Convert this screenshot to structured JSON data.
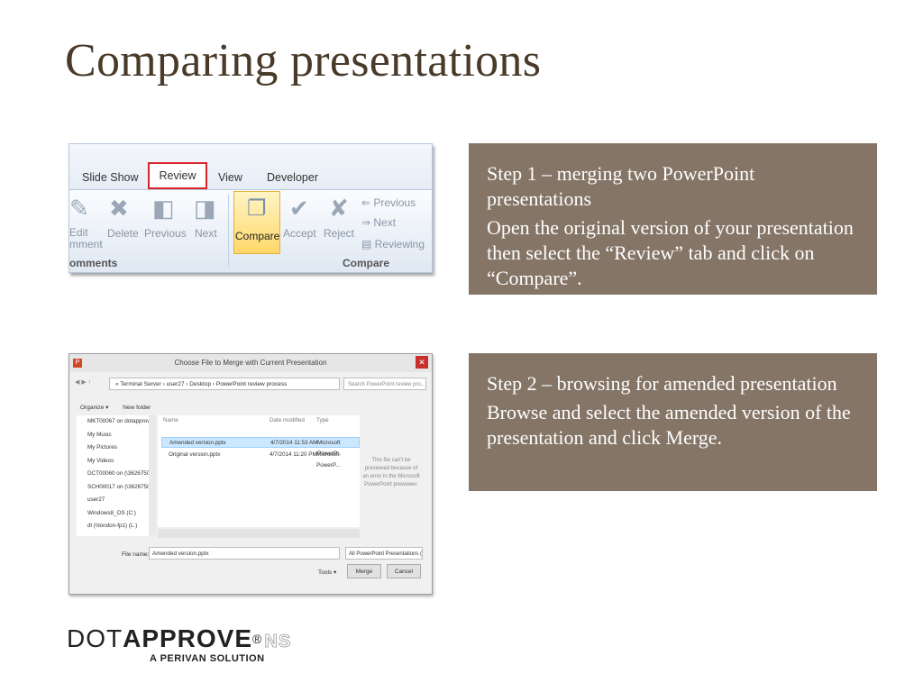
{
  "slide": {
    "title": "Comparing presentations"
  },
  "step1": {
    "heading": "Step 1 – merging two PowerPoint presentations",
    "description": "Open the original version of your presentation then select the “Review” tab and click on “Compare”."
  },
  "step2": {
    "heading": "Step 2 – browsing for amended presentation",
    "description": "Browse and select the amended version of the presentation and click Merge."
  },
  "ribbon": {
    "tabs": [
      "Slide Show",
      "Review",
      "View",
      "Developer"
    ],
    "buttons": {
      "edit": "Edit\nmment",
      "delete": "Delete",
      "previous": "Previous",
      "next": "Next",
      "compare": "Compare",
      "accept": "Accept",
      "reject": "Reject",
      "side_previous": "Previous",
      "side_next": "Next",
      "reviewing": "Reviewing"
    },
    "groups": {
      "comments": "omments",
      "compare": "Compare"
    }
  },
  "dialog": {
    "title": "Choose File to Merge with Current Presentation",
    "address": "« Terminal Server › user27 › Desktop › PowerPoint review process",
    "search_placeholder": "Search PowerPoint review pro...",
    "toolbar": {
      "organize": "Organize ▾",
      "new_folder": "New folder"
    },
    "nav_items": [
      "MKT00067 on dotapprove...",
      "My Music",
      "My Pictures",
      "My Videos",
      "DCT00060 on (\\362675090...",
      "SCH00017 on (\\362675092...",
      "user27",
      "Windows8_OS (C:)",
      "dl (\\\\london-fp1) (L:)"
    ],
    "columns": {
      "name": "Name",
      "date": "Date modified",
      "type": "Type"
    },
    "files": [
      {
        "name": "Amended version.pptx",
        "date": "4/7/2014 11:53 AM",
        "type": "Microsoft PowerP...",
        "selected": true
      },
      {
        "name": "Original version.pptx",
        "date": "4/7/2014 11:20 PM",
        "type": "Microsoft PowerP...",
        "selected": false
      }
    ],
    "preview_text": "This file can't be previewed because of an error in the Microsoft PowerPoint previewer.",
    "filename_label": "File name:",
    "filename_value": "Amended version.pptx",
    "filter": "All PowerPoint Presentations (*",
    "tools": "Tools ▾",
    "merge": "Merge",
    "cancel": "Cancel"
  },
  "logo": {
    "dot": "DOT",
    "approve": "APPROVE",
    "reg": "®",
    "ns": "NS",
    "subtitle": "A PERIVAN SOLUTION"
  },
  "colors": {
    "title": "#4a3a2a",
    "step_box": "#857566",
    "review_highlight": "#d9232b"
  }
}
